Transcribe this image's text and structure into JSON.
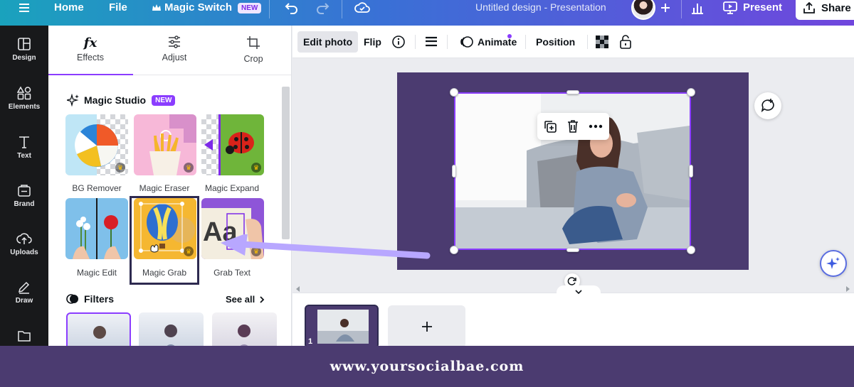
{
  "topbar": {
    "menu_icon": "hamburger-icon",
    "home": "Home",
    "file": "File",
    "magic_switch": "Magic Switch",
    "magic_switch_badge": "NEW",
    "doc_title": "Untitled design - Presentation",
    "present": "Present",
    "share": "Share"
  },
  "rail": {
    "items": [
      {
        "label": "Design",
        "icon": "design-icon"
      },
      {
        "label": "Elements",
        "icon": "elements-icon"
      },
      {
        "label": "Text",
        "icon": "text-icon"
      },
      {
        "label": "Brand",
        "icon": "brand-icon"
      },
      {
        "label": "Uploads",
        "icon": "uploads-icon"
      },
      {
        "label": "Draw",
        "icon": "draw-icon"
      },
      {
        "label": "",
        "icon": "folder-icon"
      }
    ]
  },
  "panel": {
    "tabs": [
      {
        "label": "Effects",
        "icon": "fx-icon",
        "glyph": "fx"
      },
      {
        "label": "Adjust",
        "icon": "sliders-icon"
      },
      {
        "label": "Crop",
        "icon": "crop-icon"
      }
    ],
    "magic_studio": {
      "title": "Magic Studio",
      "badge": "NEW",
      "tools": [
        {
          "label": "BG Remover"
        },
        {
          "label": "Magic Eraser"
        },
        {
          "label": "Magic Expand"
        },
        {
          "label": "Magic Edit"
        },
        {
          "label": "Magic Grab"
        },
        {
          "label": "Grab Text"
        }
      ]
    },
    "filters": {
      "title": "Filters",
      "see_all": "See all"
    }
  },
  "toolbar": {
    "edit_photo": "Edit photo",
    "flip": "Flip",
    "animate": "Animate",
    "position": "Position"
  },
  "pages": {
    "page_number": "1"
  },
  "footer": {
    "website": "www.yoursocialbae.com"
  },
  "colors": {
    "accent": "#8b3dff",
    "footer_bg": "#4b3b70",
    "rail_bg": "#18191b",
    "arrow": "#b8a7ff"
  }
}
